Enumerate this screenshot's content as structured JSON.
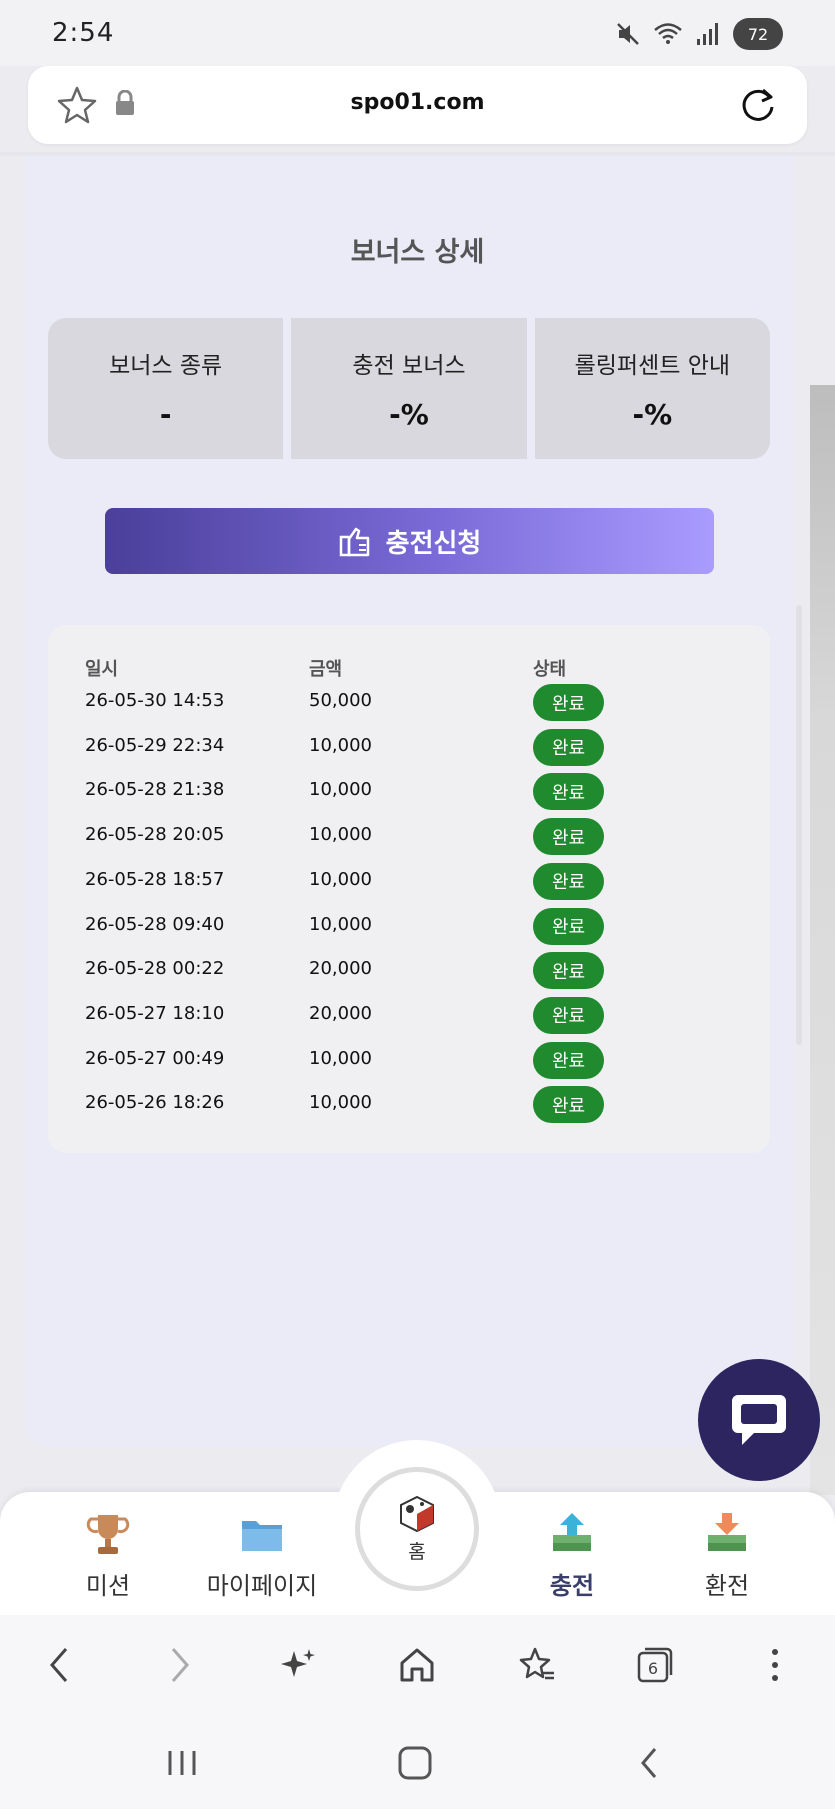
{
  "status": {
    "time": "2:54",
    "battery": "72"
  },
  "url_bar": {
    "url": "spo01.com"
  },
  "page": {
    "title": "보너스 상세"
  },
  "info": [
    {
      "label": "보너스 종류",
      "value": "-"
    },
    {
      "label": "충전 보너스",
      "value": "-%"
    },
    {
      "label": "롤링퍼센트 안내",
      "value": "-%"
    }
  ],
  "charge_button": {
    "label": "충전신청"
  },
  "history": {
    "headers": {
      "date": "일시",
      "amount": "금액",
      "status": "상태"
    },
    "rows": [
      {
        "date": "26-05-30 14:53",
        "amount": "50,000",
        "status": "완료"
      },
      {
        "date": "26-05-29 22:34",
        "amount": "10,000",
        "status": "완료"
      },
      {
        "date": "26-05-28 21:38",
        "amount": "10,000",
        "status": "완료"
      },
      {
        "date": "26-05-28 20:05",
        "amount": "10,000",
        "status": "완료"
      },
      {
        "date": "26-05-28 18:57",
        "amount": "10,000",
        "status": "완료"
      },
      {
        "date": "26-05-28 09:40",
        "amount": "10,000",
        "status": "완료"
      },
      {
        "date": "26-05-28 00:22",
        "amount": "20,000",
        "status": "완료"
      },
      {
        "date": "26-05-27 18:10",
        "amount": "20,000",
        "status": "완료"
      },
      {
        "date": "26-05-27 00:49",
        "amount": "10,000",
        "status": "완료"
      },
      {
        "date": "26-05-26 18:26",
        "amount": "10,000",
        "status": "완료"
      }
    ]
  },
  "bottom_nav": {
    "items": [
      {
        "label": "미션",
        "icon": "trophy-icon"
      },
      {
        "label": "마이페이지",
        "icon": "folder-icon"
      },
      {
        "label": "충전",
        "icon": "charge-money-icon"
      },
      {
        "label": "환전",
        "icon": "exchange-money-icon"
      }
    ],
    "home_label": "홈"
  },
  "browser_toolbar": {
    "tab_count": "6"
  },
  "colors": {
    "accent_start": "#4a3f9a",
    "accent_end": "#a99cff",
    "status_green": "#1f8a2e",
    "chat_fab": "#2c2560"
  }
}
